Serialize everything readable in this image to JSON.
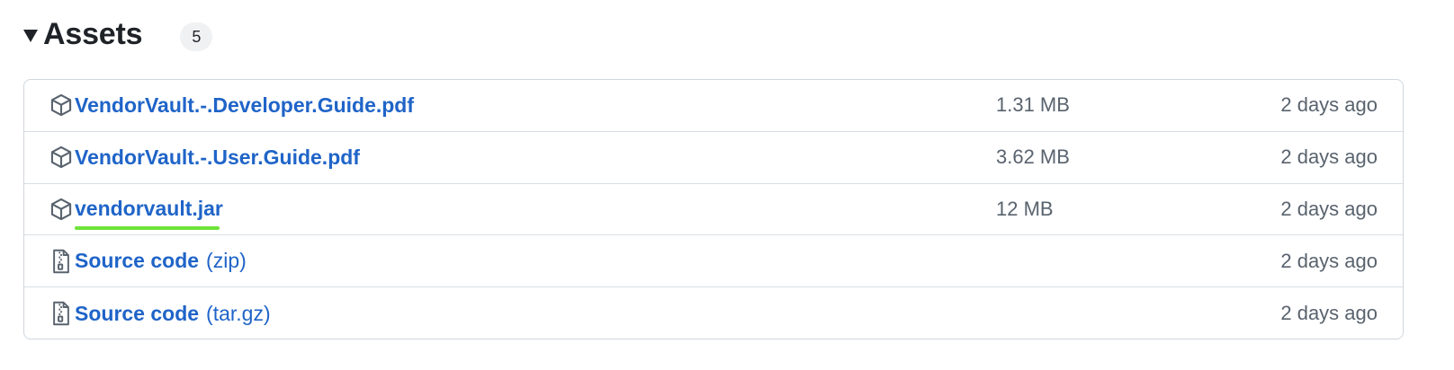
{
  "assets": {
    "title": "Assets",
    "count": "5",
    "rows": [
      {
        "name": "VendorVault.-.Developer.Guide.pdf",
        "suffix": "",
        "size": "1.31 MB",
        "date": "2 days ago",
        "icon": "package-icon"
      },
      {
        "name": "VendorVault.-.User.Guide.pdf",
        "suffix": "",
        "size": "3.62 MB",
        "date": "2 days ago",
        "icon": "package-icon"
      },
      {
        "name": "vendorvault.jar",
        "suffix": "",
        "size": "12 MB",
        "date": "2 days ago",
        "icon": "package-icon",
        "highlighted": true
      },
      {
        "name": "Source code",
        "suffix": "(zip)",
        "size": "",
        "date": "2 days ago",
        "icon": "file-zip-icon"
      },
      {
        "name": "Source code",
        "suffix": "(tar.gz)",
        "size": "",
        "date": "2 days ago",
        "icon": "file-zip-icon"
      }
    ]
  },
  "colors": {
    "link": "#1f64c8",
    "muted": "#59636e",
    "border": "#d0d7de",
    "highlight": "#6ee33a"
  }
}
